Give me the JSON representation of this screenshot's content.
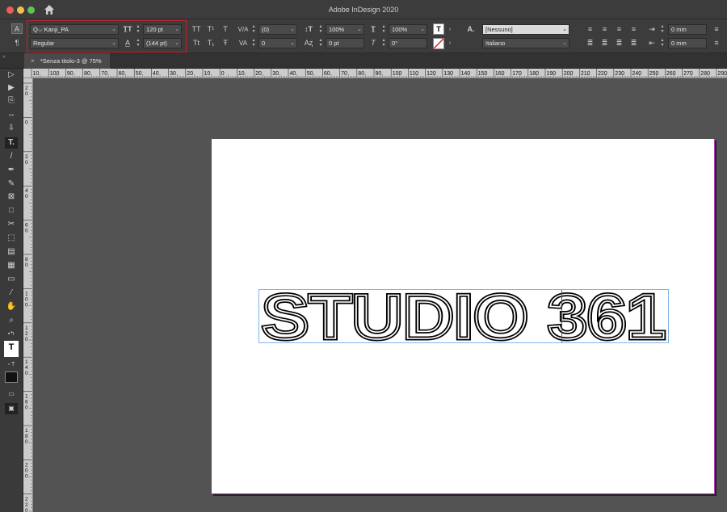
{
  "app": {
    "title": "Adobe InDesign 2020"
  },
  "control_panel": {
    "font_family": "Kanji_PA",
    "font_style": "Regular",
    "font_size": "120 pt",
    "leading": "(144 pt)",
    "kerning": "(0)",
    "tracking": "0",
    "vertical_scale": "100%",
    "horizontal_scale": "100%",
    "baseline_shift": "0 pt",
    "skew": "0°",
    "char_style": "[Nessuno]",
    "language": "Italiano",
    "left_indent": "0 mm",
    "right_indent": "0 mm",
    "case_labels": [
      "TT",
      "T¹",
      "T",
      "Tt",
      "T₁",
      "Ŧ"
    ]
  },
  "document_tab": {
    "label": "*Senza titolo-3 @ 75%"
  },
  "ruler": {
    "h_ticks": [
      "10",
      "100",
      "90",
      "80",
      "70",
      "60",
      "50",
      "40",
      "30",
      "20",
      "10",
      "0",
      "10",
      "20",
      "30",
      "40",
      "50",
      "60",
      "70",
      "80",
      "90",
      "100",
      "110",
      "120",
      "130",
      "140",
      "150",
      "160",
      "170",
      "180",
      "190",
      "200",
      "210",
      "220",
      "230",
      "240",
      "250",
      "260",
      "270",
      "280",
      "290",
      "30"
    ],
    "v_ticks": [
      "2 0",
      "0",
      "2 0",
      "4 0",
      "6 0",
      "8 0",
      "1 0 0",
      "1 2 0",
      "1 4 0",
      "1 6 0",
      "1 8 0",
      "2 0 0",
      "2 2 0"
    ]
  },
  "canvas": {
    "text": "STUDIO 361"
  },
  "colors": {
    "bg": "#535353",
    "panel": "#3c3c3c",
    "highlight": "#c0232a",
    "frame": "#7eb3ea",
    "bleed": "#b43fb4"
  }
}
